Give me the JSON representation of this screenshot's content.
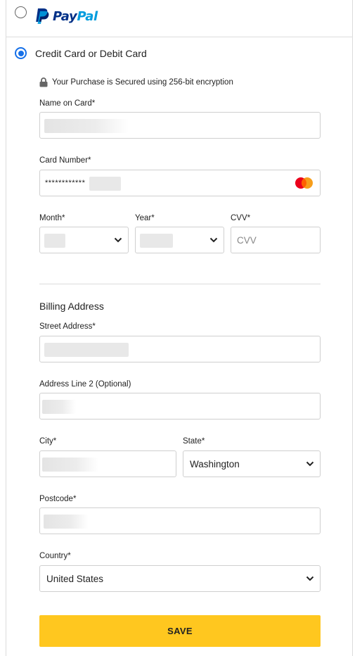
{
  "payment_methods": {
    "paypal": {
      "brand_pay": "Pay",
      "brand_pal": "Pal",
      "selected": false
    },
    "card": {
      "label": "Credit Card or Debit Card",
      "selected": true
    }
  },
  "security_note": "Your Purchase is Secured using 256-bit encryption",
  "card_form": {
    "name_label": "Name on Card*",
    "number_label": "Card Number*",
    "number_value": "************",
    "card_brand": "mastercard-icon",
    "month_label": "Month*",
    "year_label": "Year*",
    "cvv_label": "CVV*",
    "cvv_placeholder": "CVV"
  },
  "billing": {
    "title": "Billing Address",
    "street_label": "Street Address*",
    "line2_label": "Address Line 2 (Optional)",
    "city_label": "City*",
    "state_label": "State*",
    "state_value": "Washington",
    "postcode_label": "Postcode*",
    "country_label": "Country*",
    "country_value": "United States"
  },
  "save_label": "SAVE",
  "colors": {
    "accent_blue": "#1670e8",
    "save_yellow": "#ffc71f",
    "paypal_dark": "#003087",
    "paypal_light": "#009cde"
  }
}
